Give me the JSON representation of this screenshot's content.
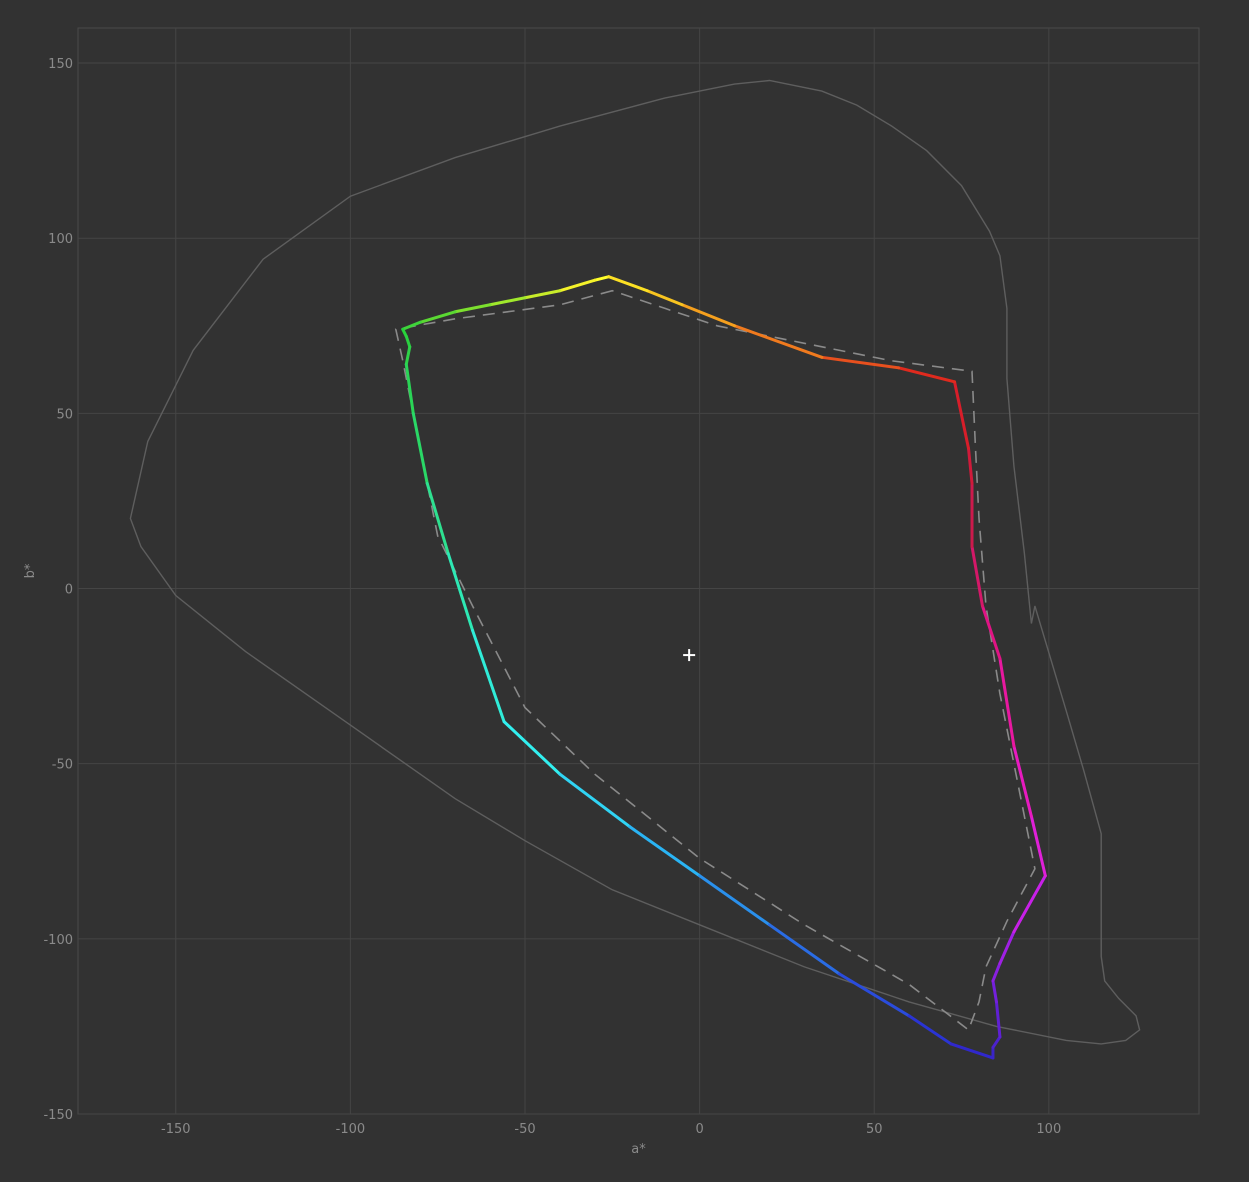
{
  "chart_data": {
    "type": "line",
    "xlabel": "a*",
    "ylabel": "b*",
    "xlim": [
      -178,
      143
    ],
    "ylim": [
      -150,
      160
    ],
    "xticks": [
      -150,
      -100,
      -50,
      0,
      50,
      100
    ],
    "yticks": [
      150,
      100,
      50,
      0,
      -50,
      -100,
      -150
    ],
    "grid": true,
    "series": [
      {
        "role": "spectral-locus-outline",
        "style": "solid",
        "color": "#5e5e5e",
        "closed": true,
        "points": [
          [
            20,
            145
          ],
          [
            10,
            144
          ],
          [
            -10,
            140
          ],
          [
            -40,
            132
          ],
          [
            -70,
            123
          ],
          [
            -100,
            112
          ],
          [
            -125,
            94
          ],
          [
            -145,
            68
          ],
          [
            -158,
            42
          ],
          [
            -163,
            20
          ],
          [
            -160,
            12
          ],
          [
            -150,
            -2
          ],
          [
            -130,
            -18
          ],
          [
            -100,
            -39
          ],
          [
            -70,
            -60
          ],
          [
            -50,
            -72
          ],
          [
            -25,
            -86
          ],
          [
            0,
            -96
          ],
          [
            30,
            -108
          ],
          [
            60,
            -118
          ],
          [
            85,
            -125
          ],
          [
            105,
            -129
          ],
          [
            115,
            -130
          ],
          [
            122,
            -129
          ],
          [
            126,
            -126
          ],
          [
            125,
            -122
          ],
          [
            120,
            -117
          ],
          [
            116,
            -112
          ],
          [
            115,
            -105
          ],
          [
            115,
            -90
          ],
          [
            115,
            -70
          ],
          [
            110,
            -52
          ],
          [
            105,
            -35
          ],
          [
            96,
            -5
          ],
          [
            95,
            -10
          ],
          [
            93,
            10
          ],
          [
            90,
            35
          ],
          [
            88,
            60
          ],
          [
            88,
            80
          ],
          [
            86,
            95
          ],
          [
            83,
            102
          ],
          [
            75,
            115
          ],
          [
            65,
            125
          ],
          [
            55,
            132
          ],
          [
            45,
            138
          ],
          [
            35,
            142
          ]
        ]
      },
      {
        "role": "reference-gamut",
        "style": "dashed",
        "color": "#8a8a8a",
        "closed": true,
        "points": [
          [
            -25,
            85
          ],
          [
            -40,
            81
          ],
          [
            -55,
            79
          ],
          [
            -70,
            77
          ],
          [
            -87,
            74
          ],
          [
            -85,
            65
          ],
          [
            -80,
            40
          ],
          [
            -75,
            15
          ],
          [
            -65,
            -5
          ],
          [
            -50,
            -34
          ],
          [
            -30,
            -53
          ],
          [
            0,
            -77
          ],
          [
            30,
            -96
          ],
          [
            60,
            -113
          ],
          [
            77,
            -126
          ],
          [
            80,
            -118
          ],
          [
            82,
            -108
          ],
          [
            88,
            -95
          ],
          [
            96,
            -80
          ],
          [
            92,
            -60
          ],
          [
            86,
            -30
          ],
          [
            82,
            -5
          ],
          [
            80,
            20
          ],
          [
            79,
            40
          ],
          [
            78,
            62
          ],
          [
            55,
            65
          ],
          [
            30,
            70
          ],
          [
            5,
            75
          ],
          [
            -10,
            80
          ]
        ]
      },
      {
        "role": "measured-gamut",
        "style": "gradient",
        "closed": true,
        "points": [
          [
            -26,
            89
          ],
          [
            -30,
            88
          ],
          [
            -40,
            85
          ],
          [
            -50,
            83
          ],
          [
            -60,
            81
          ],
          [
            -70,
            79
          ],
          [
            -80,
            76
          ],
          [
            -85,
            74
          ],
          [
            -84,
            72
          ],
          [
            -83,
            69
          ],
          [
            -84,
            64
          ],
          [
            -82,
            50
          ],
          [
            -78,
            30
          ],
          [
            -72,
            10
          ],
          [
            -65,
            -12
          ],
          [
            -56,
            -38
          ],
          [
            -40,
            -53
          ],
          [
            -20,
            -68
          ],
          [
            0,
            -82
          ],
          [
            20,
            -96
          ],
          [
            40,
            -110
          ],
          [
            60,
            -122
          ],
          [
            72,
            -130
          ],
          [
            84,
            -134
          ],
          [
            84,
            -131
          ],
          [
            86,
            -128
          ],
          [
            85,
            -118
          ],
          [
            84,
            -112
          ],
          [
            86,
            -107
          ],
          [
            90,
            -98
          ],
          [
            99,
            -82
          ],
          [
            95,
            -65
          ],
          [
            90,
            -45
          ],
          [
            86,
            -20
          ],
          [
            81,
            -5
          ],
          [
            78,
            12
          ],
          [
            78,
            30
          ],
          [
            77,
            40
          ],
          [
            73,
            59
          ],
          [
            57,
            63
          ],
          [
            35,
            66
          ],
          [
            10,
            75
          ],
          [
            -5,
            81
          ],
          [
            -15,
            85
          ]
        ],
        "colors": [
          "#ffff2a",
          "#f4f22a",
          "#c8ec2a",
          "#a0e82c",
          "#7ce02e",
          "#5ad832",
          "#3ed43a",
          "#28d23a",
          "#2ad040",
          "#2ed248",
          "#2ad456",
          "#2ad866",
          "#2ee090",
          "#2ee8b4",
          "#30ecd8",
          "#32f0f0",
          "#30d4f4",
          "#2ab4f4",
          "#2a90ec",
          "#2a6ce4",
          "#2a4cdc",
          "#2a34d4",
          "#3028cc",
          "#3a24c8",
          "#4c22cc",
          "#6020d4",
          "#7420dc",
          "#8a20e0",
          "#a020e4",
          "#c820e8",
          "#e020d8",
          "#e81ac0",
          "#e818a0",
          "#e01484",
          "#d41868",
          "#cc1a4c",
          "#d01a3a",
          "#d81e2a",
          "#e02a1e",
          "#e8501e",
          "#f07a1e",
          "#f5a01e",
          "#f8c420",
          "#fce024",
          "#ffff2a"
        ]
      }
    ],
    "white_point": {
      "a": -3,
      "b": -19,
      "marker": "+",
      "color": "#ffffff"
    }
  }
}
